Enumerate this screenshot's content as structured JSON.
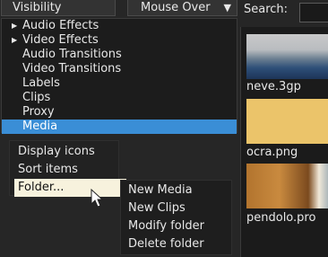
{
  "toolbar": {
    "visibility_label": "Visibility",
    "mouse_over_label": "Mouse Over",
    "dropdown_arrow": "▼",
    "search_label": "Search:",
    "search_value": ""
  },
  "tree": {
    "items": [
      {
        "label": "Audio Effects",
        "expandable": true
      },
      {
        "label": "Video Effects",
        "expandable": true
      },
      {
        "label": "Audio Transitions",
        "expandable": false
      },
      {
        "label": "Video Transitions",
        "expandable": false
      },
      {
        "label": "Labels",
        "expandable": false
      },
      {
        "label": "Clips",
        "expandable": false
      },
      {
        "label": "Proxy",
        "expandable": false
      },
      {
        "label": "Media",
        "expandable": false,
        "selected": true
      }
    ],
    "expand_glyph": "▶"
  },
  "context_menu": {
    "items": [
      "Display icons",
      "Sort items",
      "Folder..."
    ]
  },
  "submenu": {
    "items": [
      "New Media",
      "New Clips",
      "Modify folder",
      "Delete folder"
    ]
  },
  "thumbnails": [
    {
      "label": "neve.3gp"
    },
    {
      "label": "ocra.png"
    },
    {
      "label": "pendolo.pro"
    }
  ],
  "colors": {
    "selection": "#3a8ed6",
    "menu_highlight": "#f7f2dd",
    "ocra_swatch": "#ebc46a"
  }
}
